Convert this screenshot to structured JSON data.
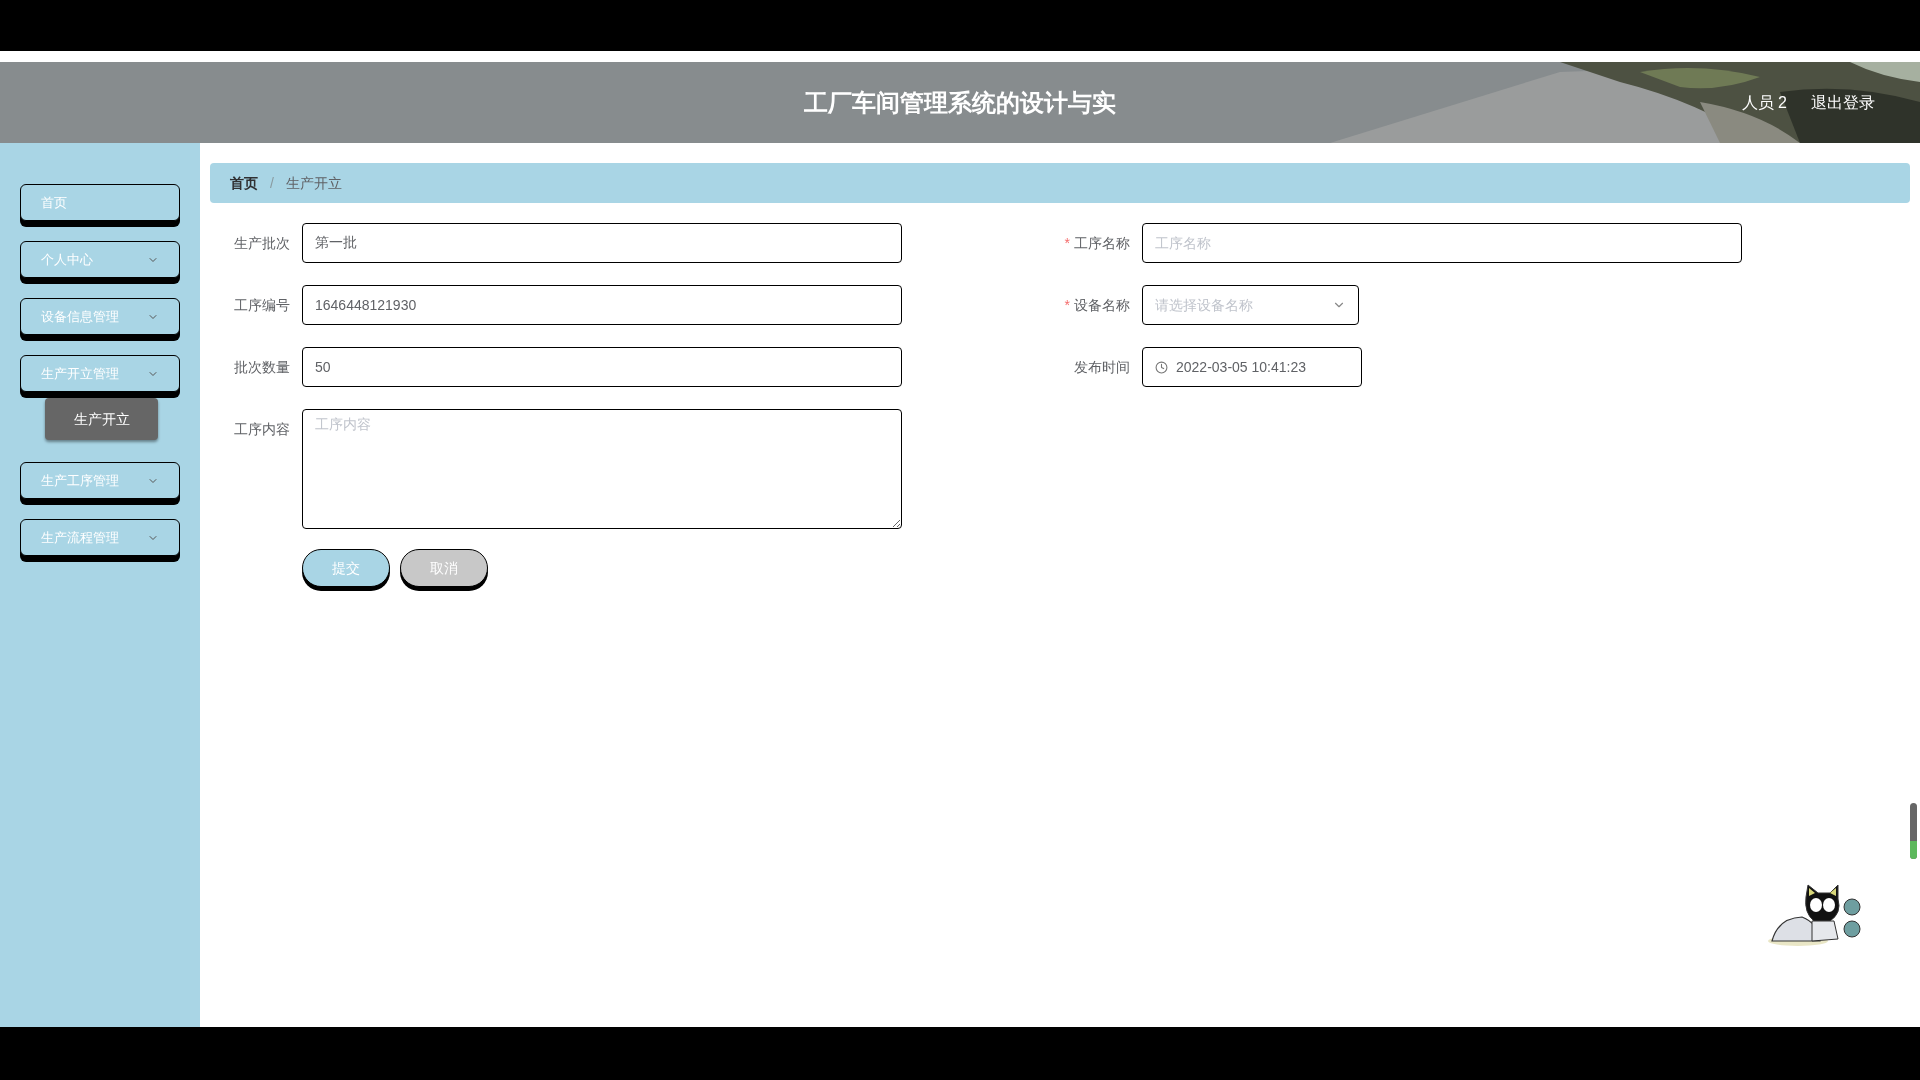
{
  "header": {
    "title": "工厂车间管理系统的设计与实",
    "user": "人员 2",
    "logout": "退出登录"
  },
  "sidebar": {
    "items": [
      {
        "label": "首页",
        "kind": "link"
      },
      {
        "label": "个人中心",
        "kind": "menu"
      },
      {
        "label": "设备信息管理",
        "kind": "menu"
      },
      {
        "label": "生产开立管理",
        "kind": "menu",
        "children": [
          {
            "label": "生产开立",
            "selected": true
          }
        ]
      },
      {
        "label": "生产工序管理",
        "kind": "menu"
      },
      {
        "label": "生产流程管理",
        "kind": "menu"
      }
    ]
  },
  "breadcrumb": {
    "separator": "/",
    "items": [
      "首页",
      "生产开立"
    ]
  },
  "form": {
    "required_mark": "*",
    "left": [
      {
        "label": "生产批次",
        "kind": "text",
        "required": false,
        "value": "第一批"
      },
      {
        "label": "工序编号",
        "kind": "text",
        "required": false,
        "value": "1646448121930"
      },
      {
        "label": "批次数量",
        "kind": "text",
        "required": false,
        "value": "50"
      },
      {
        "label": "工序内容",
        "kind": "textarea",
        "required": false,
        "placeholder": "工序内容"
      }
    ],
    "right": [
      {
        "label": "工序名称",
        "kind": "text",
        "required": true,
        "placeholder": "工序名称"
      },
      {
        "label": "设备名称",
        "kind": "select",
        "required": true,
        "placeholder": "请选择设备名称"
      },
      {
        "label": "发布时间",
        "kind": "datetime",
        "required": false,
        "value": "2022-03-05 10:41:23"
      }
    ],
    "buttons": [
      {
        "label": "提交",
        "kind": "primary"
      },
      {
        "label": "取消",
        "kind": "secondary"
      }
    ]
  }
}
